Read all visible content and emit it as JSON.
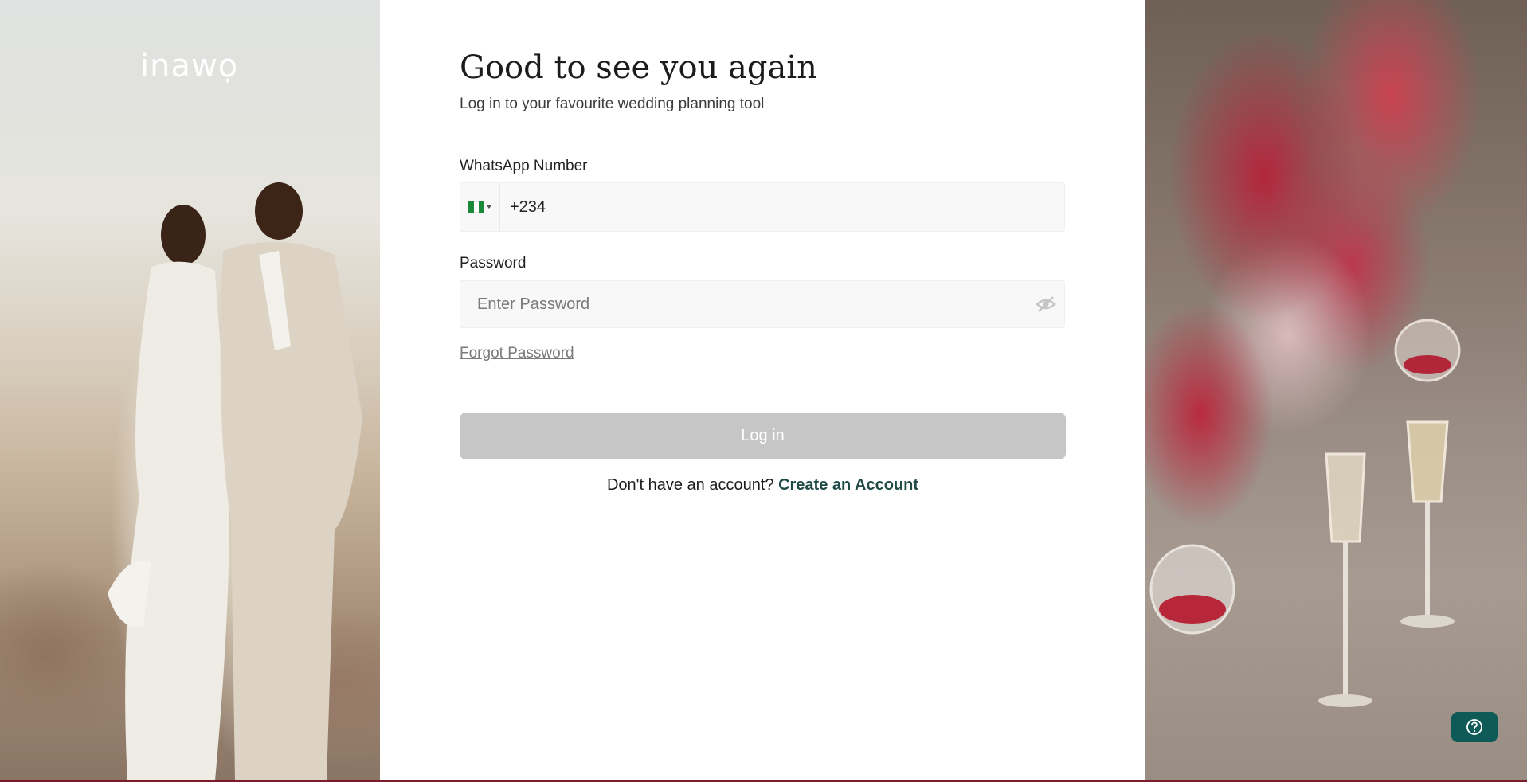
{
  "brand": {
    "logo_text": "inawọ"
  },
  "login": {
    "heading": "Good to see you again",
    "subheading": "Log in to your favourite wedding planning tool",
    "whatsapp_label": "WhatsApp Number",
    "country_code": "+234",
    "country_flag": "nigeria-flag-icon",
    "password_label": "Password",
    "password_placeholder": "Enter Password",
    "forgot_password": "Forgot Password",
    "login_button": "Log in",
    "no_account_text": "Don't have an account?",
    "create_account_link": "Create an Account"
  },
  "colors": {
    "accent": "#1f4a45",
    "button_disabled": "#c6c6c6",
    "help_button": "#0d5a56",
    "bottom_bar": "#7b1c2a"
  },
  "icons": {
    "password_toggle": "eye-off-icon",
    "help": "question-mark-icon"
  }
}
